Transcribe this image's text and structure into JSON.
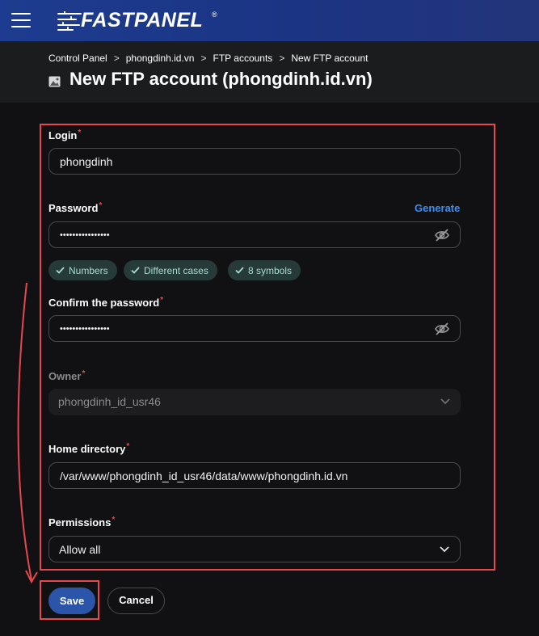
{
  "brand": {
    "name": "FASTPANEL",
    "reg": "®"
  },
  "breadcrumb": [
    "Control Panel",
    "phongdinh.id.vn",
    "FTP accounts",
    "New FTP account"
  ],
  "breadcrumb_sep": ">",
  "page": {
    "title": "New FTP account (phongdinh.id.vn)"
  },
  "form": {
    "login": {
      "label": "Login",
      "value": "phongdinh"
    },
    "password": {
      "label": "Password",
      "value": "••••••••••••••••",
      "generate_label": "Generate"
    },
    "checks": [
      "Numbers",
      "Different cases",
      "8 symbols"
    ],
    "confirm": {
      "label": "Confirm the password",
      "value": "••••••••••••••••"
    },
    "owner": {
      "label": "Owner",
      "value": "phongdinh_id_usr46"
    },
    "home": {
      "label": "Home directory",
      "value": "/var/www/phongdinh_id_usr46/data/www/phongdinh.id.vn"
    },
    "permissions": {
      "label": "Permissions",
      "value": "Allow all"
    },
    "required_mark": "*"
  },
  "actions": {
    "save": "Save",
    "cancel": "Cancel"
  },
  "colors": {
    "accent": "#3d8ef0",
    "topbar": "#1d3c8f",
    "required": "#e5484d",
    "highlight": "#e5484d",
    "chip_bg": "#253a39"
  }
}
